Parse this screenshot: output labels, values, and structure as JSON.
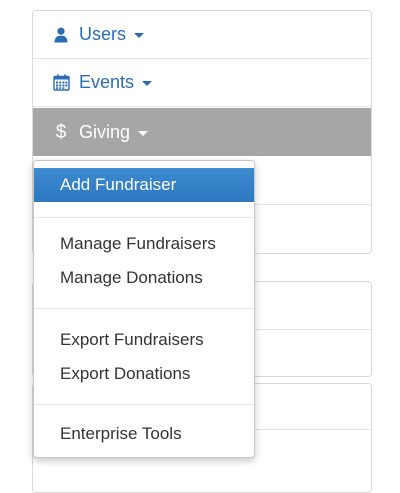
{
  "nav": {
    "users": {
      "label": "Users",
      "icon": "user-icon"
    },
    "events": {
      "label": "Events",
      "icon": "calendar-icon"
    },
    "giving": {
      "label": "Giving",
      "icon": "dollar-icon",
      "symbol": "$"
    }
  },
  "giving_menu": {
    "items": [
      {
        "label": "Add Fundraiser",
        "active": true
      },
      {
        "label": "Manage Fundraisers"
      },
      {
        "label": "Manage Donations"
      },
      {
        "label": "Export Fundraisers"
      },
      {
        "label": "Export Donations"
      },
      {
        "label": "Enterprise Tools"
      }
    ]
  },
  "colors": {
    "link": "#2a6db4",
    "active_nav_bg": "#a6a6a6",
    "active_menu_bg": "#3482c8",
    "menu_text": "#333333"
  }
}
